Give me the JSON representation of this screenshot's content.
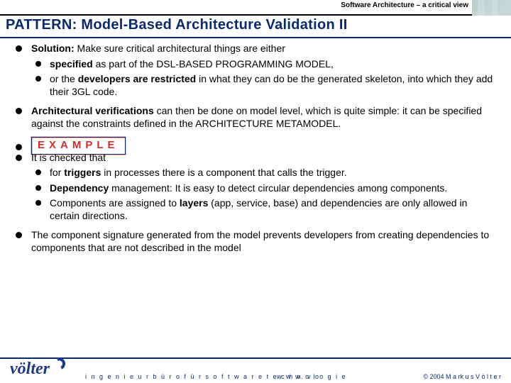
{
  "header": {
    "supertitle": "Software Architecture – a critical view",
    "pattern_title": "PATTERN: Model-Based Architecture Validation II"
  },
  "content": {
    "solution_lead": "Solution:",
    "solution_rest": " Make sure critical architectural things are either",
    "solution_sub": [
      {
        "pre": "",
        "b1": "specified",
        "mid": " as part of the DSL-BASED PROGRAMMING MODEL,",
        "b2": "",
        "post": ""
      },
      {
        "pre": "or the ",
        "b1": "developers are restricted",
        "mid": " in what they can do be the generated skeleton, into which they add their 3GL code.",
        "b2": "",
        "post": ""
      }
    ],
    "arch_lead": "Architectural verifications",
    "arch_rest": " can then be done on model level, which is quite simple: it can be specified against the constraints defined in the ARCHITECTURE METAMODEL.",
    "example_label": "EXAMPLE",
    "checked_intro": "It is checked that",
    "checked_sub": [
      {
        "pre": "for ",
        "b1": "triggers",
        "mid": " in processes there is a component that calls the trigger.",
        "b2": "",
        "post": ""
      },
      {
        "pre": "",
        "b1": "Dependency",
        "mid": " management: It is easy to detect circular dependencies among components.",
        "b2": "",
        "post": ""
      },
      {
        "pre": "Components are assigned to ",
        "b1": "layers",
        "mid": " (app, service, base) and dependencies are only allowed in certain directions.",
        "b2": "",
        "post": ""
      }
    ],
    "signature": "The component signature generated from the model prevents developers from creating dependencies to components that are not described in the model"
  },
  "footer": {
    "logo": "völter",
    "tagline": "i n g e n i e u r b ü r o   f ü r   s o f t w a r e t e c h n o l o g i e",
    "url": "w w w. v o",
    "copyright": "© 2004  M a rk u s V ö l t e r"
  }
}
